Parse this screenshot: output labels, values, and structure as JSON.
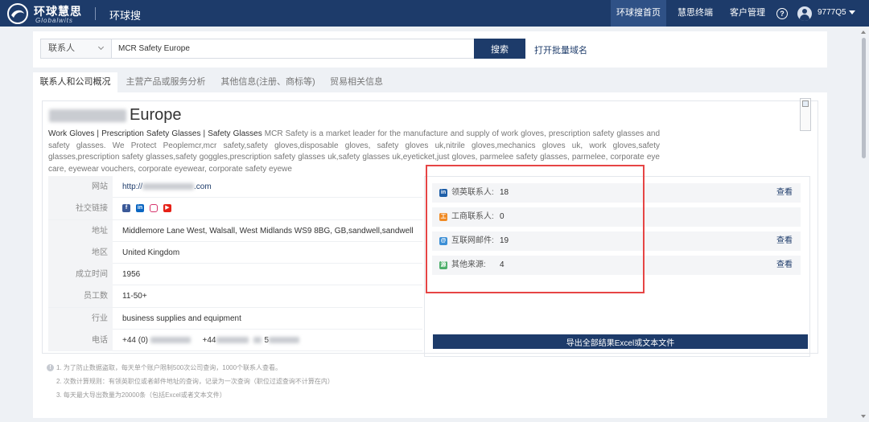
{
  "header": {
    "brand": "环球慧思",
    "brand_en": "Globalwits",
    "app_name": "环球搜",
    "nav": [
      "环球搜首页",
      "慧思终端",
      "客户管理"
    ],
    "active_nav": "环球搜首页",
    "username": "9777Q5"
  },
  "search": {
    "type_label": "联系人",
    "query": "MCR Safety Europe",
    "button_label": "搜索",
    "batch_link": "打开批量域名"
  },
  "tabs": [
    "联系人和公司概况",
    "主营产品或服务分析",
    "其他信息(注册、商标等)",
    "贸易相关信息"
  ],
  "company": {
    "name_visible": "Europe",
    "description_lead": "Work Gloves | Prescription Safety Glasses | Safety Glasses",
    "description_rest": " MCR Safety is a market leader for the manufacture and supply of work gloves, prescription safety glasses and safety glasses. We Protect Peoplemcr,mcr safety,safety gloves,disposable gloves, safety gloves uk,nitrile gloves,mechanics gloves uk, work gloves,safety glasses,prescription safety glasses,safety goggles,prescription safety glasses uk,safety glasses uk,eyeticket,just gloves, parmelee safety glasses, parmelee, corporate eye care, eyewear vouchers, corporate eyewear, corporate safety eyewe"
  },
  "info": {
    "website_label": "网站",
    "website_prefix": "http://",
    "website_suffix": ".com",
    "social_label": "社交链接",
    "social_icons": [
      "facebook-icon",
      "linkedin-icon",
      "instagram-icon",
      "youtube-icon"
    ],
    "address_label": "地址",
    "address": "Middlemore Lane West, Walsall, West Midlands WS9 8BG, GB,sandwell,sandwell",
    "region_label": "地区",
    "region": "United Kingdom",
    "founded_label": "成立时间",
    "founded": "1956",
    "employees_label": "员工数",
    "employees": "11-50+",
    "industry_label": "行业",
    "industry": "business supplies and equipment",
    "phone_label": "电话",
    "phone_1_prefix": "+44 (0)",
    "phone_2_prefix": "+44",
    "phone_3_fragment": "5"
  },
  "contacts": [
    {
      "label": "领英联系人:",
      "count": "18",
      "view": "查看",
      "icon": "linkedin-icon",
      "color": "#1f5fa8",
      "glyph": "in"
    },
    {
      "label": "工商联系人:",
      "count": "0",
      "view": "",
      "icon": "business-registry-icon",
      "color": "#f08a24",
      "glyph": "工"
    },
    {
      "label": "互联网邮件:",
      "count": "19",
      "view": "查看",
      "icon": "email-icon",
      "color": "#3c8fd6",
      "glyph": "@"
    },
    {
      "label": "其他来源:",
      "count": "4",
      "view": "查看",
      "icon": "other-source-icon",
      "color": "#4cae6a",
      "glyph": "源"
    }
  ],
  "export_label": "导出全部结果Excel或文本文件",
  "notes": [
    "1. 为了防止数据盗取，每天单个账户限制500次公司查询，1000个联系人查看。",
    "2. 次数计算规则：有领英职位或者邮件地址的查询，记录为一次查询（职位过滤查询不计算在内）",
    "3. 每天最大导出数量为20000条（包括Excel或者文本文件）"
  ],
  "colors": {
    "primary": "#1d3b6a",
    "highlight_border": "#e64545"
  }
}
